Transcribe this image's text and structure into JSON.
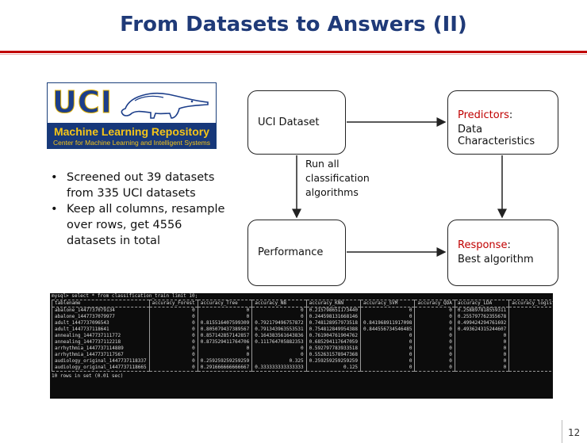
{
  "slide": {
    "title": "From Datasets to Answers (II)",
    "page_number": "12"
  },
  "logo": {
    "text": "UCI",
    "line1": "Machine Learning Repository",
    "line2": "Center for Machine Learning and Intelligent Systems"
  },
  "bullets": [
    "Screened out 39 datasets from 335 UCI datasets",
    "Keep all columns, resample over rows, get 4556 datasets in total"
  ],
  "diagram": {
    "uci_dataset": "UCI Dataset",
    "predictors_label": "Predictors",
    "predictors_value": "Data Characteristics",
    "performance": "Performance",
    "response_label": "Response",
    "response_value": "Best algorithm",
    "edge_label": [
      "Run all",
      "classification",
      "algorithms"
    ]
  },
  "terminal": {
    "command": "mysql> select * from classification_train limit 10;",
    "headers": [
      "tablename",
      "accuracy_Forest",
      "accuracy_Tree",
      "accuracy_NB",
      "accuracy_KNN",
      "accuracy_SVM",
      "accuracy_QDA",
      "accuracy_LDA",
      "accuracy_logistic"
    ],
    "rows": [
      [
        "abalone_1447737079134",
        "0",
        "0",
        "0",
        "0.215798651173440",
        "0",
        "0",
        "0.258897818559311",
        "0"
      ],
      [
        "abalone_1447737079977",
        "0",
        "0",
        "0",
        "0.244598131668146",
        "0",
        "0",
        "0.255797762355678",
        "0"
      ],
      [
        "adult_1447737096543",
        "0",
        "0.815516407599309",
        "0.792179496757872",
        "0.748128957973518",
        "0.841968911917098",
        "0",
        "0.499424294761692",
        "0"
      ],
      [
        "adult_1447737118641",
        "0",
        "0.805079437389567",
        "0.791343963553531",
        "0.754812849954388",
        "0.844556734546485",
        "0",
        "0.493624315244607",
        "0"
      ],
      [
        "annealing_1447737111772",
        "0",
        "0.857142857142857",
        "0.164383561643836",
        "0.761904761904762",
        "0",
        "0",
        "0",
        "0"
      ],
      [
        "annealing_1447737112218",
        "0",
        "0.873529411764706",
        "0.111764705882353",
        "0.685294117647059",
        "0",
        "0",
        "0",
        "0"
      ],
      [
        "arrhythmia_1447737114889",
        "0",
        "0",
        "0",
        "0.592797783933518",
        "0",
        "0",
        "0",
        "0"
      ],
      [
        "arrhythmia_1447737117567",
        "0",
        "0",
        "0",
        "0.552631578947368",
        "0",
        "0",
        "0",
        "0"
      ],
      [
        "audiology_original_1447737118337",
        "0",
        "0.259259259259259",
        "0.325",
        "0.259259259259259",
        "0",
        "0",
        "0",
        "0"
      ],
      [
        "audiology_original_1447737118665",
        "0",
        "0.291666666666667",
        "0.333333333333333",
        "0.125",
        "0",
        "0",
        "0",
        "0"
      ]
    ],
    "footer": "10 rows in set (0.01 sec)"
  }
}
